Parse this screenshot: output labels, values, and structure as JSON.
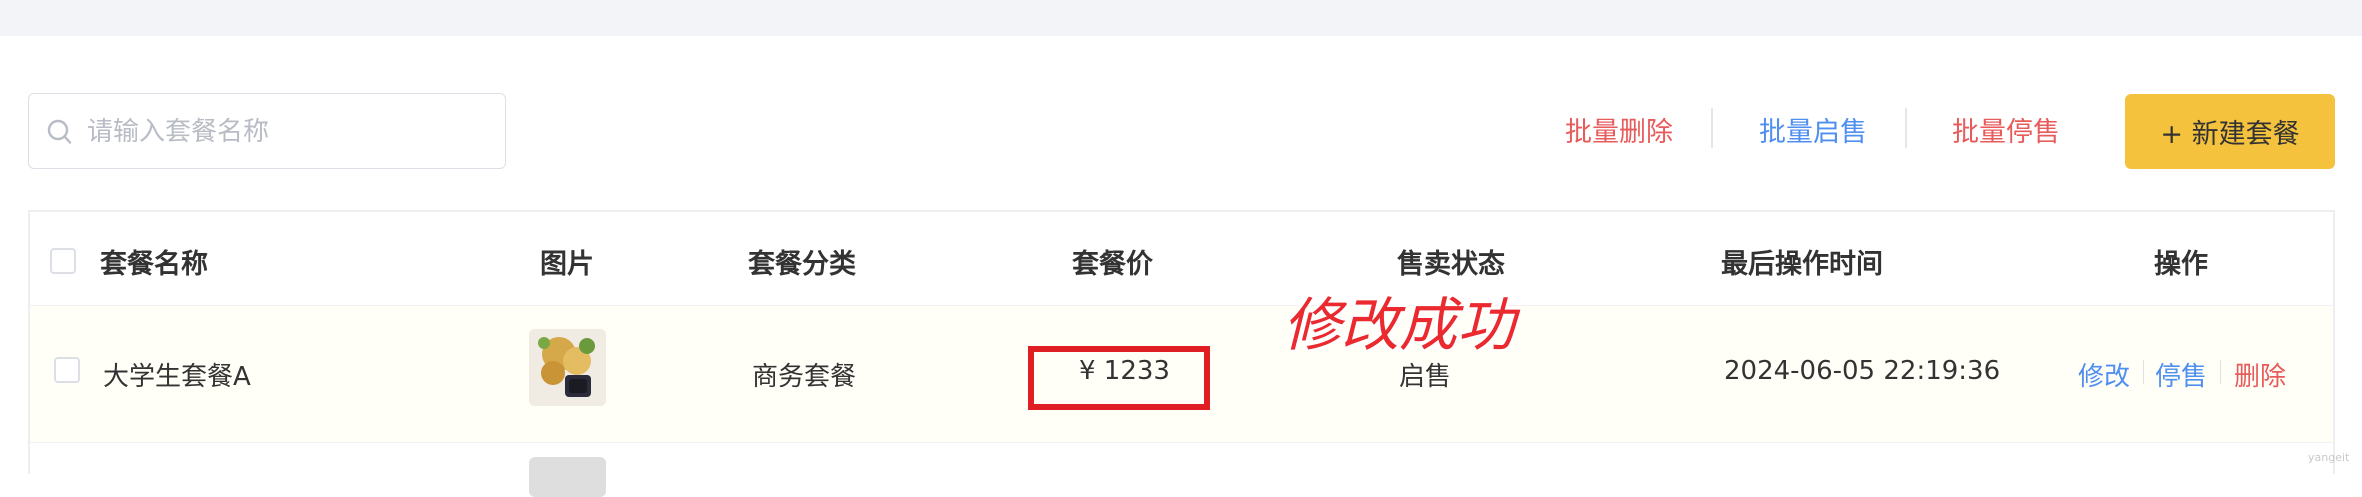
{
  "search": {
    "placeholder": "请输入套餐名称",
    "value": ""
  },
  "actions": {
    "batch_delete": "批量删除",
    "batch_enable": "批量启售",
    "batch_disable": "批量停售",
    "create": "+ 新建套餐"
  },
  "table": {
    "headers": {
      "name": "套餐名称",
      "image": "图片",
      "category": "套餐分类",
      "price": "套餐价",
      "status": "售卖状态",
      "updated": "最后操作时间",
      "operations": "操作"
    },
    "rows": [
      {
        "name": "大学生套餐A",
        "category": "商务套餐",
        "price": "¥ 1233",
        "status": "启售",
        "updated": "2024-06-05 22:19:36",
        "op_edit": "修改",
        "op_toggle": "停售",
        "op_delete": "删除"
      }
    ]
  },
  "annotation": {
    "text": "修改成功"
  },
  "watermark": "yangeit",
  "colors": {
    "danger": "#e85b5b",
    "primary": "#4e8ff0",
    "accent": "#f5c23e",
    "highlight": "#e01f25"
  }
}
